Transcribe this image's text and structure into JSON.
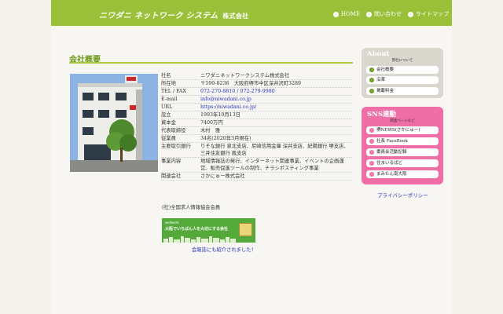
{
  "header": {
    "logo_text": "ニワダニ ネットワーク システム",
    "logo_suffix": "株式会社",
    "nav": [
      {
        "label": "HOME",
        "icon": "chevron-right-icon"
      },
      {
        "label": "問い合わせ",
        "icon": "chevron-right-icon"
      },
      {
        "label": "サイトマップ",
        "icon": "chevron-right-icon"
      }
    ]
  },
  "main": {
    "title": "会社概要",
    "company_info": [
      {
        "key": "社名",
        "value": "ニワダニネットワークシステム株式会社"
      },
      {
        "key": "所在地",
        "value": "〒599-8236　大阪府堺市中区深井沢町3289"
      },
      {
        "key": "TEL / FAX",
        "value": "072-270-8810 / 072-279-9980"
      },
      {
        "key": "E-mail",
        "value": "info@niwadani.co.jp"
      },
      {
        "key": "URL",
        "value": "https://niwadani.co.jp/"
      },
      {
        "key": "設立",
        "value": "1993年10月13日"
      },
      {
        "key": "資本金",
        "value": "7400万円"
      },
      {
        "key": "代表取締役",
        "value": "木村　雅"
      },
      {
        "key": "従業員",
        "value": "34名(2020年3月現在)"
      },
      {
        "key": "主要取引銀行",
        "value": "りそな銀行 泉北支店、尼崎信用金庫 深井支店、紀陽銀行 堺支店、三井住友銀行 鳳支店"
      },
      {
        "key": "事業内容",
        "value": "地域情報誌の発行、インターネット関連事業、イベントの企画運営、販売促進ツールの制作、チラシポスティング事業"
      },
      {
        "key": "関連会社",
        "value": "さかにゅー株式会社"
      }
    ],
    "membership": "(社)全国求人情報協会会員",
    "banner": {
      "label_small": "wellwork",
      "label_main": "大阪でいちばん人を大切にする会社"
    },
    "banner_caption": "会報誌にも紹介されました！"
  },
  "sidebar": {
    "about": {
      "heading": "About",
      "subheading": "弊社について",
      "items": [
        "会社概要",
        "沿革",
        "掲載料金"
      ]
    },
    "sns": {
      "heading": "SNS連動",
      "subheading": "関連ページなど",
      "items": [
        "堺NEWS(さかにゅー)",
        "社長 FaceBook",
        "委員会活動記録",
        "住まいるぱど",
        "まみたん南大阪"
      ]
    },
    "privacy_link": "プライバシーポリシー"
  },
  "colors": {
    "header_green": "#99c038",
    "title_green": "#6b9a1a",
    "sns_pink": "#ef6ea6",
    "about_grey": "#d9d7ce",
    "link_blue": "#2233bb"
  }
}
